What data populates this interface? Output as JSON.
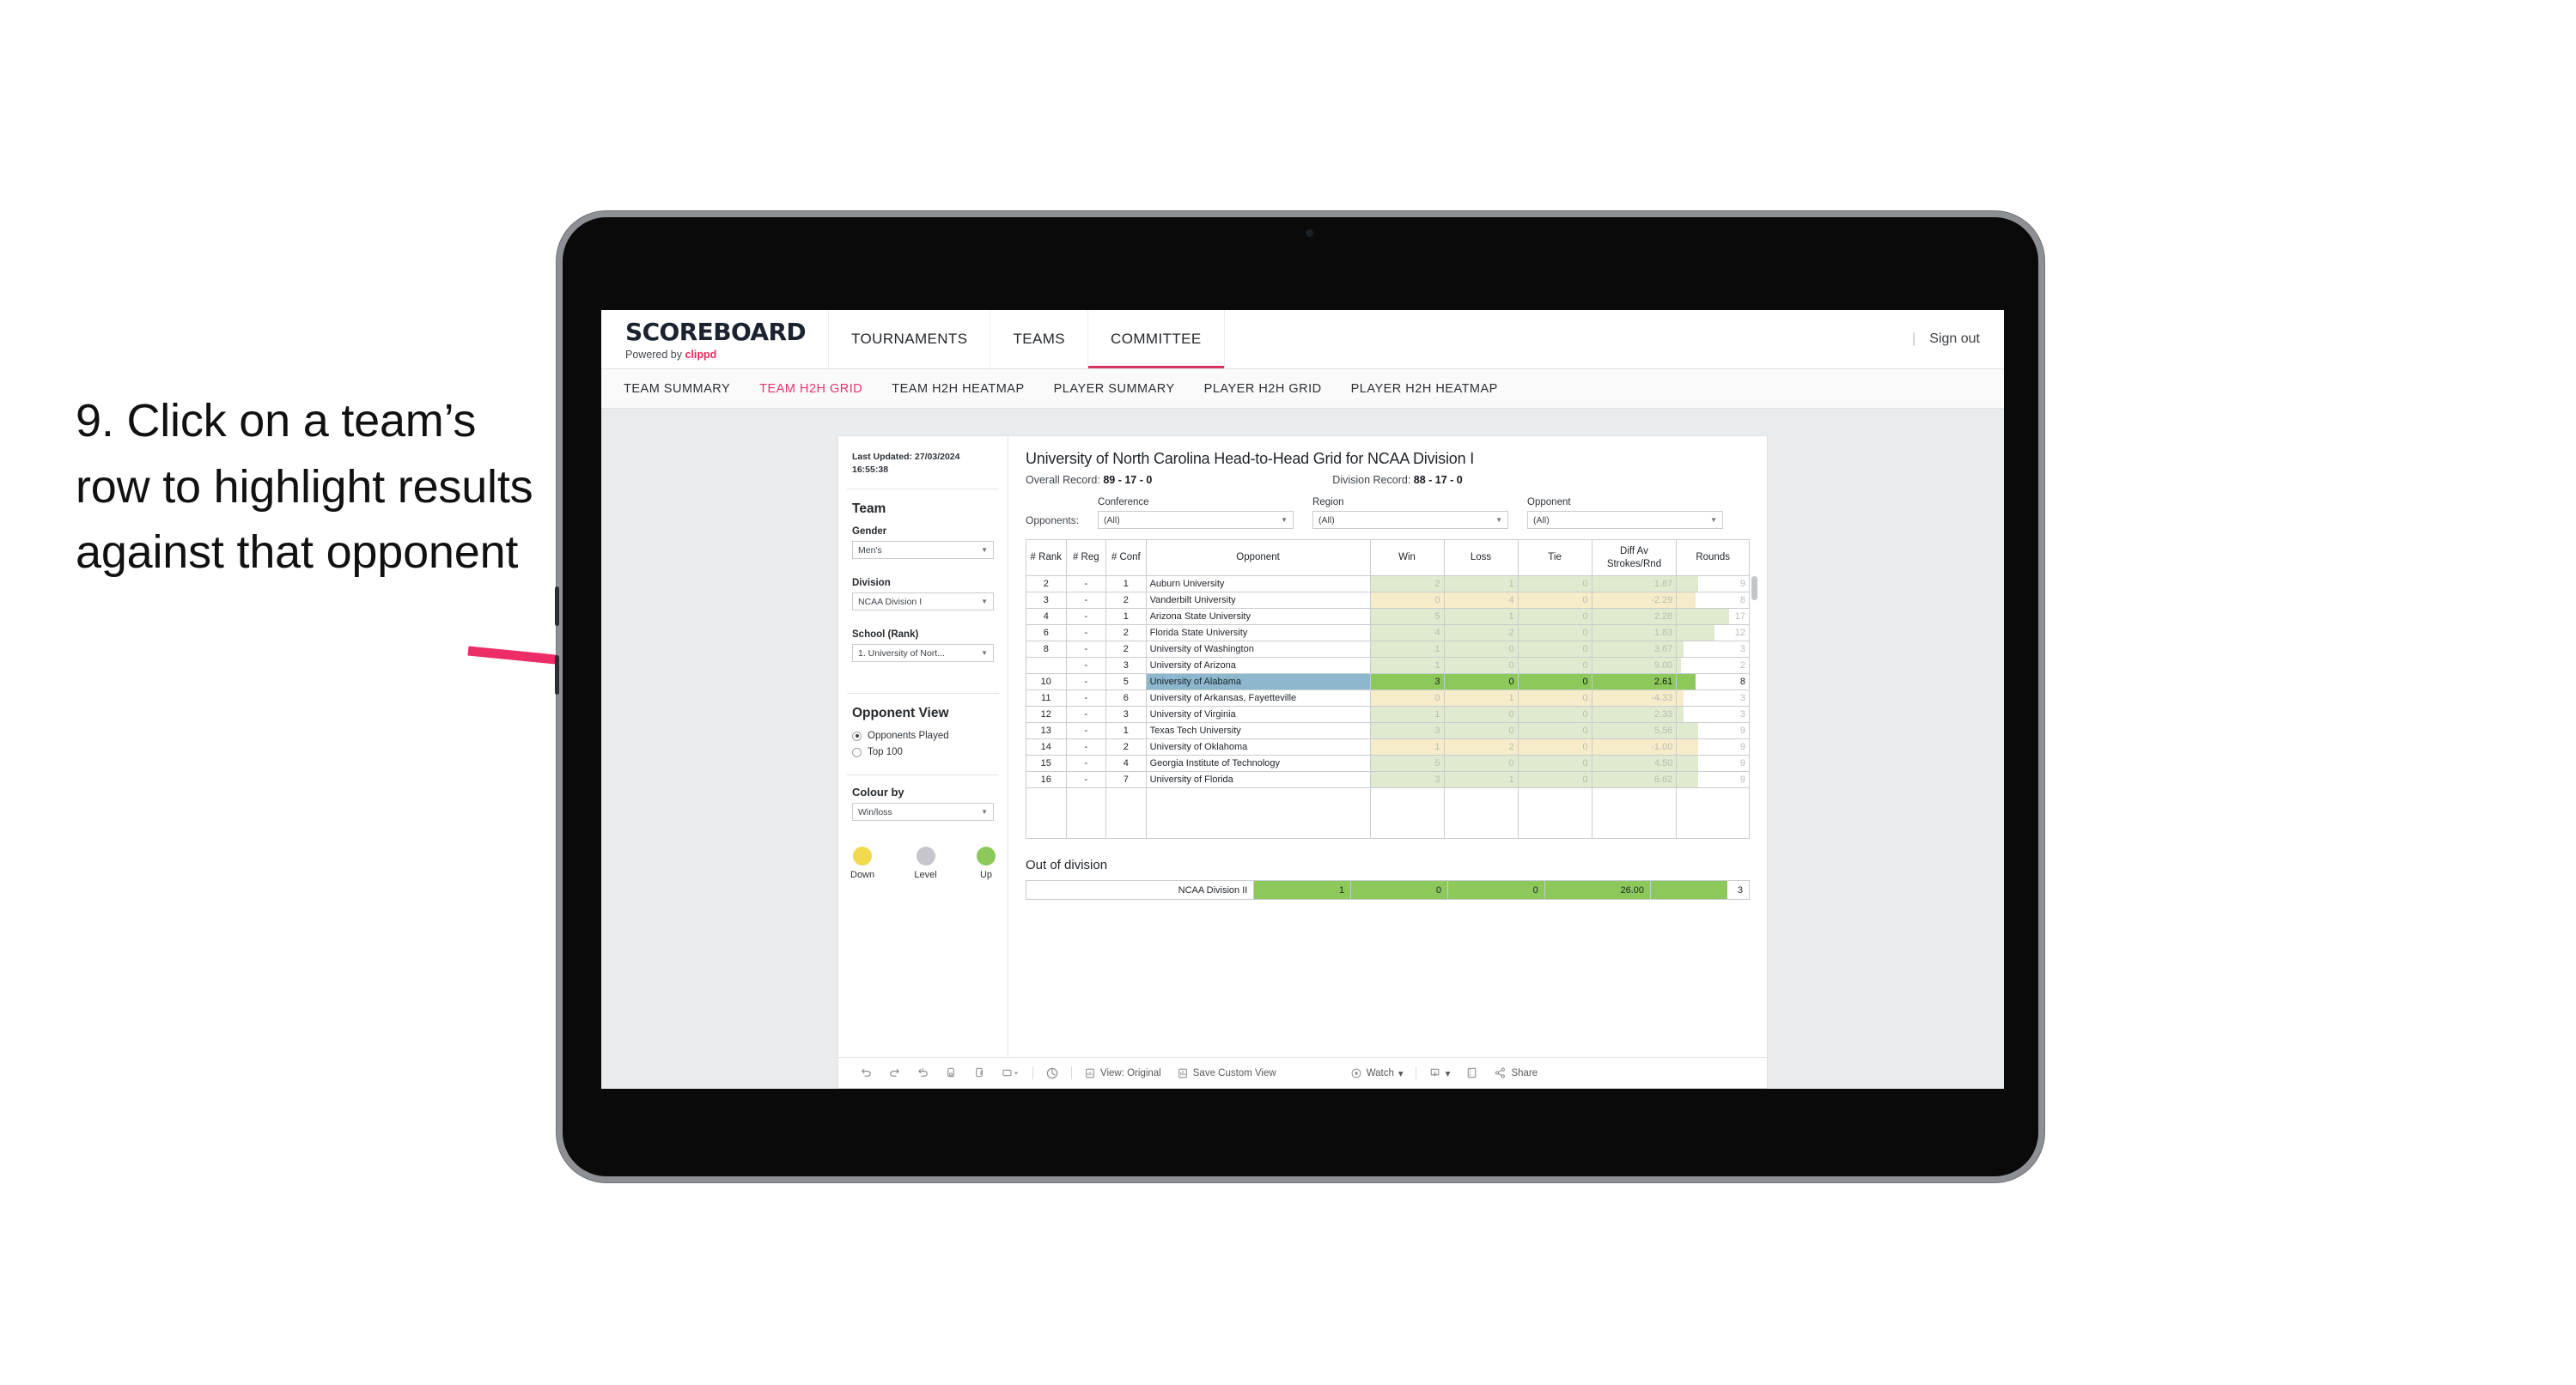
{
  "annotation": {
    "text": "9. Click on a team’s row to highlight results against that opponent"
  },
  "appbar": {
    "brand_title": "SCOREBOARD",
    "brand_sub_prefix": "Powered by ",
    "brand_sub_brand": "clippd",
    "nav": [
      {
        "label": "TOURNAMENTS",
        "active": false
      },
      {
        "label": "TEAMS",
        "active": false
      },
      {
        "label": "COMMITTEE",
        "active": true
      }
    ],
    "separator": "|",
    "sign_out": "Sign out"
  },
  "subtabs": [
    {
      "label": "TEAM SUMMARY",
      "active": false
    },
    {
      "label": "TEAM H2H GRID",
      "active": true
    },
    {
      "label": "TEAM H2H HEATMAP",
      "active": false
    },
    {
      "label": "PLAYER SUMMARY",
      "active": false
    },
    {
      "label": "PLAYER H2H GRID",
      "active": false
    },
    {
      "label": "PLAYER H2H HEATMAP",
      "active": false
    }
  ],
  "sidebar": {
    "last_updated": "Last Updated: 27/03/2024 16:55:38",
    "team_heading": "Team",
    "gender": {
      "label": "Gender",
      "value": "Men's"
    },
    "division": {
      "label": "Division",
      "value": "NCAA Division I"
    },
    "school": {
      "label": "School (Rank)",
      "value": "1. University of Nort..."
    },
    "opponent_view": {
      "heading": "Opponent View",
      "options": [
        {
          "label": "Opponents Played",
          "selected": true
        },
        {
          "label": "Top 100",
          "selected": false
        }
      ]
    },
    "colour_by": {
      "label": "Colour by",
      "value": "Win/loss"
    },
    "legend": [
      {
        "label": "Down",
        "color": "#f2d94e"
      },
      {
        "label": "Level",
        "color": "#c4c7cc"
      },
      {
        "label": "Up",
        "color": "#8cc85a"
      }
    ]
  },
  "main": {
    "title": "University of North Carolina Head-to-Head Grid for NCAA Division I",
    "overall_record_label": "Overall Record: ",
    "overall_record_value": "89 - 17 - 0",
    "division_record_label": "Division Record: ",
    "division_record_value": "88 - 17 - 0",
    "opponents_label": "Opponents:",
    "filters": [
      {
        "label": "Conference",
        "value": "(All)"
      },
      {
        "label": "Region",
        "value": "(All)"
      },
      {
        "label": "Opponent",
        "value": "(All)"
      }
    ],
    "columns": [
      "# Rank",
      "# Reg",
      "# Conf",
      "Opponent",
      "Win",
      "Loss",
      "Tie",
      "Diff Av Strokes/Rnd",
      "Rounds"
    ],
    "rows": [
      {
        "rank": "2",
        "reg": "-",
        "conf": "1",
        "opponent": "Auburn University",
        "win": "2",
        "loss": "1",
        "tie": "0",
        "diff": "1.67",
        "rounds": "9",
        "trend": "up",
        "selected": false,
        "rounds_fill": 0.3
      },
      {
        "rank": "3",
        "reg": "-",
        "conf": "2",
        "opponent": "Vanderbilt University",
        "win": "0",
        "loss": "4",
        "tie": "0",
        "diff": "-2.29",
        "rounds": "8",
        "trend": "down",
        "selected": false,
        "rounds_fill": 0.26
      },
      {
        "rank": "4",
        "reg": "-",
        "conf": "1",
        "opponent": "Arizona State University",
        "win": "5",
        "loss": "1",
        "tie": "0",
        "diff": "2.28",
        "rounds": "17",
        "trend": "up",
        "selected": false,
        "rounds_fill": 0.72
      },
      {
        "rank": "6",
        "reg": "-",
        "conf": "2",
        "opponent": "Florida State University",
        "win": "4",
        "loss": "2",
        "tie": "0",
        "diff": "1.83",
        "rounds": "12",
        "trend": "up",
        "selected": false,
        "rounds_fill": 0.52
      },
      {
        "rank": "8",
        "reg": "-",
        "conf": "2",
        "opponent": "University of Washington",
        "win": "1",
        "loss": "0",
        "tie": "0",
        "diff": "3.67",
        "rounds": "3",
        "trend": "up",
        "selected": false,
        "rounds_fill": 0.09
      },
      {
        "rank": "",
        "reg": "-",
        "conf": "3",
        "opponent": "University of Arizona",
        "win": "1",
        "loss": "0",
        "tie": "0",
        "diff": "9.00",
        "rounds": "2",
        "trend": "up",
        "selected": false,
        "rounds_fill": 0.06
      },
      {
        "rank": "10",
        "reg": "-",
        "conf": "5",
        "opponent": "University of Alabama",
        "win": "3",
        "loss": "0",
        "tie": "0",
        "diff": "2.61",
        "rounds": "8",
        "trend": "up",
        "selected": true,
        "rounds_fill": 0.26
      },
      {
        "rank": "11",
        "reg": "-",
        "conf": "6",
        "opponent": "University of Arkansas, Fayetteville",
        "win": "0",
        "loss": "1",
        "tie": "0",
        "diff": "-4.33",
        "rounds": "3",
        "trend": "down",
        "selected": false,
        "rounds_fill": 0.09
      },
      {
        "rank": "12",
        "reg": "-",
        "conf": "3",
        "opponent": "University of Virginia",
        "win": "1",
        "loss": "0",
        "tie": "0",
        "diff": "2.33",
        "rounds": "3",
        "trend": "up",
        "selected": false,
        "rounds_fill": 0.09
      },
      {
        "rank": "13",
        "reg": "-",
        "conf": "1",
        "opponent": "Texas Tech University",
        "win": "3",
        "loss": "0",
        "tie": "0",
        "diff": "5.56",
        "rounds": "9",
        "trend": "up",
        "selected": false,
        "rounds_fill": 0.3
      },
      {
        "rank": "14",
        "reg": "-",
        "conf": "2",
        "opponent": "University of Oklahoma",
        "win": "1",
        "loss": "2",
        "tie": "0",
        "diff": "-1.00",
        "rounds": "9",
        "trend": "down",
        "selected": false,
        "rounds_fill": 0.3
      },
      {
        "rank": "15",
        "reg": "-",
        "conf": "4",
        "opponent": "Georgia Institute of Technology",
        "win": "5",
        "loss": "0",
        "tie": "0",
        "diff": "4.50",
        "rounds": "9",
        "trend": "up",
        "selected": false,
        "rounds_fill": 0.3
      },
      {
        "rank": "16",
        "reg": "-",
        "conf": "7",
        "opponent": "University of Florida",
        "win": "3",
        "loss": "1",
        "tie": "0",
        "diff": "6.62",
        "rounds": "9",
        "trend": "up",
        "selected": false,
        "rounds_fill": 0.3
      }
    ],
    "out_of_division": {
      "heading": "Out of division",
      "row": {
        "label": "NCAA Division II",
        "win": "1",
        "loss": "0",
        "tie": "0",
        "diff": "26.00",
        "rounds": "3",
        "rounds_fill": 0.78
      }
    }
  },
  "toolbar": {
    "view_original": "View: Original",
    "save_custom_view": "Save Custom View",
    "watch": "Watch",
    "share": "Share",
    "caret": "▾"
  },
  "colors": {
    "accent": "#e8336a",
    "up_fill": "#8cc85a",
    "up_dim": "#dfeace",
    "down_dim": "#f7ecc9",
    "selected_row": "#8cb7cd"
  }
}
